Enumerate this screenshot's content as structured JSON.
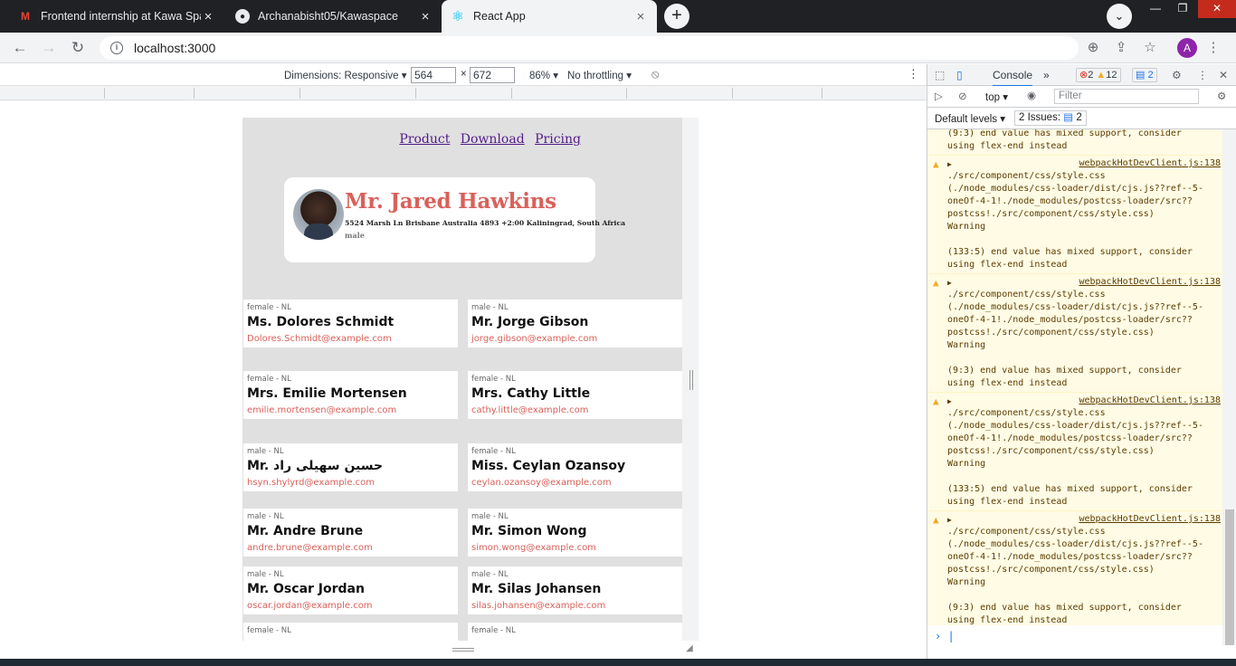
{
  "browser": {
    "tabs": [
      {
        "title": "Frontend internship at Kawa Space",
        "icon": "gmail-icon"
      },
      {
        "title": "Archanabisht05/Kawaspace",
        "icon": "github-icon"
      },
      {
        "title": "React App",
        "icon": "react-icon"
      }
    ],
    "new_tab": "+",
    "url": "localhost:3000",
    "profile_initial": "A"
  },
  "device_toolbar": {
    "dimensions_label": "Dimensions: Responsive",
    "width": "564",
    "times": "×",
    "height": "672",
    "zoom": "86%",
    "throttling": "No throttling"
  },
  "app": {
    "nav": [
      "Product",
      "Download",
      "Pricing"
    ],
    "hero": {
      "name": "Mr. Jared Hawkins",
      "address": "5524 Marsh Ln Brisbane Australia 4893 +2:00 Kaliningrad, South Africa",
      "gender": "male"
    },
    "cards": [
      {
        "meta": "female - NL",
        "name": "Ms. Dolores Schmidt",
        "email": "Dolores.Schmidt@example.com"
      },
      {
        "meta": "male - NL",
        "name": "Mr. Jorge Gibson",
        "email": "jorge.gibson@example.com"
      },
      {
        "meta": "female - NL",
        "name": "Mrs. Emilie Mortensen",
        "email": "emilie.mortensen@example.com"
      },
      {
        "meta": "female - NL",
        "name": "Mrs. Cathy Little",
        "email": "cathy.little@example.com"
      },
      {
        "meta": "male - NL",
        "name": "Mr. حسین سهیلی راد",
        "email": "hsyn.shylyrd@example.com"
      },
      {
        "meta": "female - NL",
        "name": "Miss. Ceylan Ozansoy",
        "email": "ceylan.ozansoy@example.com"
      },
      {
        "meta": "male - NL",
        "name": "Mr. Andre Brune",
        "email": "andre.brune@example.com"
      },
      {
        "meta": "male - NL",
        "name": "Mr. Simon Wong",
        "email": "simon.wong@example.com"
      },
      {
        "meta": "male - NL",
        "name": "Mr. Oscar Jordan",
        "email": "oscar.jordan@example.com"
      },
      {
        "meta": "male - NL",
        "name": "Mr. Silas Johansen",
        "email": "silas.johansen@example.com"
      },
      {
        "meta": "female - NL",
        "name": "",
        "email": ""
      },
      {
        "meta": "female - NL",
        "name": "",
        "email": ""
      }
    ]
  },
  "devtools": {
    "tab_console": "Console",
    "more_tabs": "»",
    "errors": "2",
    "warnings": "12",
    "messages": "2",
    "context": "top",
    "filter_placeholder": "Filter",
    "levels": "Default levels",
    "issues": "2 Issues:",
    "issues_count": "2",
    "console_messages": [
      {
        "source": "",
        "text": "(9:3) end value has mixed support, consider\nusing flex-end instead"
      },
      {
        "source": "webpackHotDevClient.js:138",
        "text": "./src/component/css/style.css\n(./node_modules/css-loader/dist/cjs.js??ref--5-\noneOf-4-1!./node_modules/postcss-loader/src??\npostcss!./src/component/css/style.css)\nWarning\n\n(133:5) end value has mixed support, consider\nusing flex-end instead"
      },
      {
        "source": "webpackHotDevClient.js:138",
        "text": "./src/component/css/style.css\n(./node_modules/css-loader/dist/cjs.js??ref--5-\noneOf-4-1!./node_modules/postcss-loader/src??\npostcss!./src/component/css/style.css)\nWarning\n\n(9:3) end value has mixed support, consider\nusing flex-end instead"
      },
      {
        "source": "webpackHotDevClient.js:138",
        "text": "./src/component/css/style.css\n(./node_modules/css-loader/dist/cjs.js??ref--5-\noneOf-4-1!./node_modules/postcss-loader/src??\npostcss!./src/component/css/style.css)\nWarning\n\n(133:5) end value has mixed support, consider\nusing flex-end instead"
      },
      {
        "source": "webpackHotDevClient.js:138",
        "text": "./src/component/css/style.css\n(./node_modules/css-loader/dist/cjs.js??ref--5-\noneOf-4-1!./node_modules/postcss-loader/src??\npostcss!./src/component/css/style.css)\nWarning\n\n(9:3) end value has mixed support, consider\nusing flex-end instead"
      }
    ],
    "prompt": "›"
  },
  "colors": {
    "accent": "#d9615a",
    "link": "#551a8b",
    "warning_bg": "#fffbe5"
  }
}
